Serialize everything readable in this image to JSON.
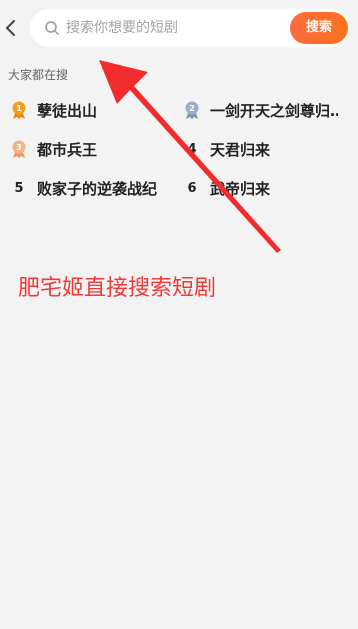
{
  "search": {
    "placeholder": "搜索你想要的短剧",
    "button_label": "搜索"
  },
  "hot": {
    "title": "大家都在搜",
    "items": [
      {
        "rank": "1",
        "title": "孽徒出山",
        "medal": "gold"
      },
      {
        "rank": "2",
        "title": "一剑开天之剑尊归…",
        "medal": "silver"
      },
      {
        "rank": "3",
        "title": "都市兵王",
        "medal": "bronze"
      },
      {
        "rank": "4",
        "title": "天君归来",
        "medal": ""
      },
      {
        "rank": "5",
        "title": "败家子的逆袭战纪",
        "medal": ""
      },
      {
        "rank": "6",
        "title": "武帝归来",
        "medal": ""
      }
    ]
  },
  "annotation": {
    "caption": "肥宅姬直接搜索短剧",
    "color": "#f03a3a"
  },
  "colors": {
    "accent": "#f9731d",
    "background": "#f3f3f3",
    "gold": "#f0a020",
    "silver": "#9bb0c8",
    "bronze": "#f3b48a"
  }
}
